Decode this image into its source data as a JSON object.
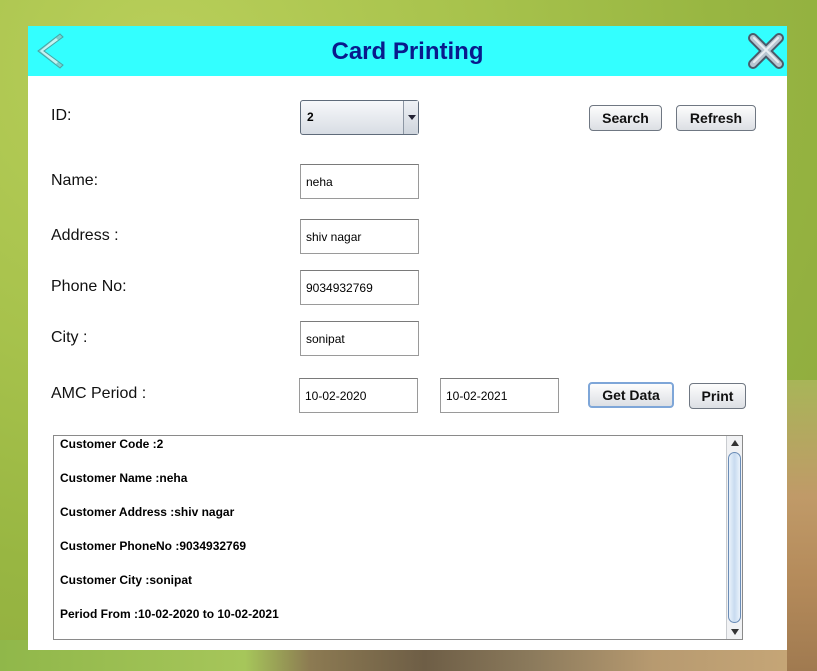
{
  "window": {
    "title": "Card Printing",
    "back_icon": "back-arrow-icon",
    "close_icon": "close-x-icon",
    "titlebar_color": "#33ffff",
    "title_color": "#0a1a8c"
  },
  "form": {
    "id_label": "ID:",
    "id_value": "2",
    "name_label": "Name:",
    "name_value": "neha",
    "address_label": "Address :",
    "address_value": "shiv nagar",
    "phone_label": "Phone No:",
    "phone_value": "9034932769",
    "city_label": "City :",
    "city_value": "sonipat",
    "amc_label": "AMC Period :",
    "amc_from": "10-02-2020",
    "amc_to": "10-02-2021"
  },
  "buttons": {
    "search": "Search",
    "refresh": "Refresh",
    "get_data": "Get Data",
    "print": "Print"
  },
  "report": {
    "lines": [
      "Customer Code :2",
      "Customer Name :neha",
      "Customer Address :shiv nagar",
      "Customer PhoneNo :9034932769",
      "Customer City :sonipat",
      "Period From :10-02-2020 to 10-02-2021"
    ]
  }
}
